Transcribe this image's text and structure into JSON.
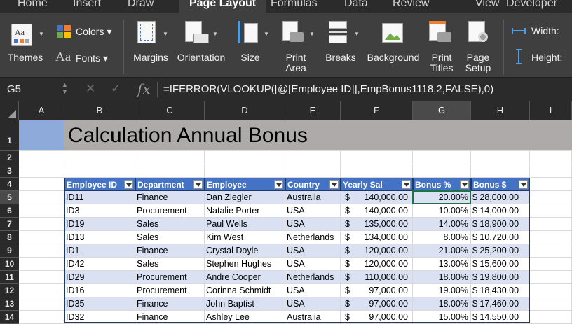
{
  "ribbon_tabs": [
    "Home",
    "Insert",
    "Draw",
    "Page Layout",
    "Formulas",
    "Data",
    "Review",
    "View",
    "Developer"
  ],
  "active_tab": "Page Layout",
  "ribbon": {
    "themes": "Themes",
    "colors": "Colors",
    "fonts": "Fonts",
    "margins": "Margins",
    "orientation": "Orientation",
    "size": "Size",
    "print_area_1": "Print",
    "print_area_2": "Area",
    "breaks": "Breaks",
    "background": "Background",
    "print_titles_1": "Print",
    "print_titles_2": "Titles",
    "page_setup_1": "Page",
    "page_setup_2": "Setup",
    "width": "Width:",
    "height": "Height:"
  },
  "formula_bar": {
    "name_box": "G5",
    "fx": "fx",
    "formula": "=IFERROR(VLOOKUP([@[Employee ID]],EmpBonus1118,2,FALSE),0)"
  },
  "columns": [
    "A",
    "B",
    "C",
    "D",
    "E",
    "F",
    "G",
    "H",
    "I"
  ],
  "selected_column": "G",
  "rows": [
    "1",
    "2",
    "3",
    "4",
    "5",
    "6",
    "7",
    "8",
    "9",
    "10",
    "11",
    "12",
    "13",
    "14"
  ],
  "selected_row": "5",
  "sheet": {
    "title": "Calculation Annual Bonus",
    "headers": [
      "Employee ID",
      "Department",
      "Employee",
      "Country",
      "Yearly Sal",
      "Bonus %",
      "Bonus $"
    ],
    "data": [
      [
        "ID11",
        "Finance",
        "Dan Ziegler",
        "Australia",
        "$",
        "140,000.00",
        "20.00%",
        "$ 28,000.00"
      ],
      [
        "ID3",
        "Procurement",
        "Natalie Porter",
        "USA",
        "$",
        "140,000.00",
        "10.00%",
        "$ 14,000.00"
      ],
      [
        "ID19",
        "Sales",
        "Paul Wells",
        "USA",
        "$",
        "135,000.00",
        "14.00%",
        "$ 18,900.00"
      ],
      [
        "ID13",
        "Sales",
        "Kim West",
        "Netherlands",
        "$",
        "134,000.00",
        "8.00%",
        "$ 10,720.00"
      ],
      [
        "ID1",
        "Finance",
        "Crystal Doyle",
        "USA",
        "$",
        "120,000.00",
        "21.00%",
        "$ 25,200.00"
      ],
      [
        "ID42",
        "Sales",
        "Stephen Hughes",
        "USA",
        "$",
        "120,000.00",
        "13.00%",
        "$ 15,600.00"
      ],
      [
        "ID29",
        "Procurement",
        "Andre Cooper",
        "Netherlands",
        "$",
        "110,000.00",
        "18.00%",
        "$ 19,800.00"
      ],
      [
        "ID16",
        "Procurement",
        "Corinna Schmidt",
        "USA",
        "$",
        "97,000.00",
        "19.00%",
        "$ 18,430.00"
      ],
      [
        "ID35",
        "Finance",
        "John Baptist",
        "USA",
        "$",
        "97,000.00",
        "18.00%",
        "$ 17,460.00"
      ],
      [
        "ID32",
        "Finance",
        "Ashley Lee",
        "Australia",
        "$",
        "97,000.00",
        "15.00%",
        "$ 14,550.00"
      ]
    ]
  },
  "colors": {
    "ribbon": "#3f3f3f",
    "header_fill": "#4472c4",
    "band_fill": "#d9e1f2",
    "title_fill": "#aeaaaa",
    "a1_fill": "#8eaadb",
    "selection": "#217346"
  }
}
